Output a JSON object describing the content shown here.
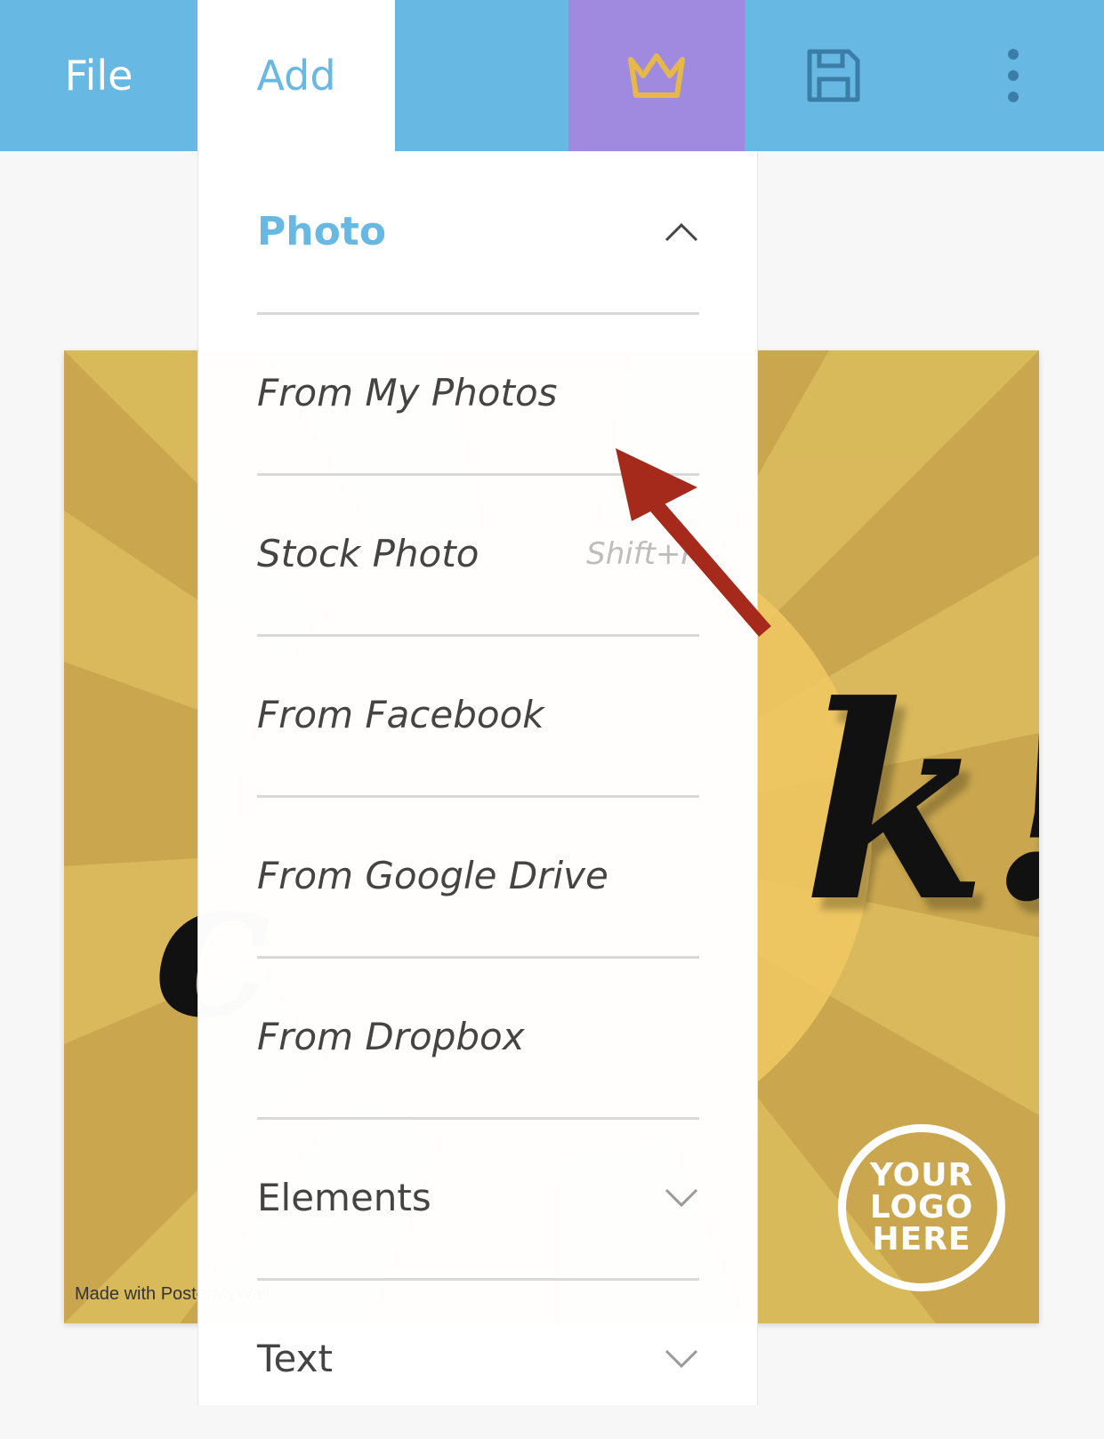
{
  "topbar": {
    "file_label": "File",
    "add_label": "Add",
    "icons": {
      "premium": "crown-icon",
      "save": "floppy-disk-icon",
      "more": "vertical-dots-icon"
    },
    "colors": {
      "bar": "#67b8e3",
      "premium": "#a08ae0",
      "crown": "#e6b84a"
    }
  },
  "menu": {
    "photo_header": "Photo",
    "items": [
      {
        "label": "From My Photos",
        "shortcut": ""
      },
      {
        "label": "Stock Photo",
        "shortcut": "Shift+P"
      },
      {
        "label": "From Facebook",
        "shortcut": ""
      },
      {
        "label": "From Google Drive",
        "shortcut": ""
      },
      {
        "label": "From Dropbox",
        "shortcut": ""
      }
    ],
    "elements_label": "Elements",
    "text_label": "Text"
  },
  "poster": {
    "script_right": "k!",
    "script_left": "c",
    "logo_lines": [
      "YOUR",
      "LOGO",
      "HERE"
    ],
    "watermark": "Made with PosterMyWall",
    "colors": {
      "base": "#caa74e",
      "ray": "#dcbd5e",
      "glow": "#efc862"
    }
  }
}
